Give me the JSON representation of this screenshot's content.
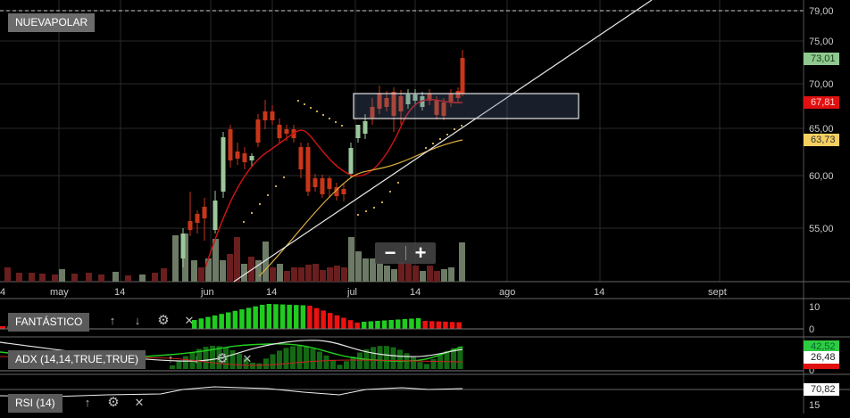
{
  "chart": {
    "symbol": "NUEVAPOLAR",
    "price_axis": {
      "ticks": [
        "79,00",
        "75,00",
        "70,00",
        "65,00",
        "60,00",
        "55,00"
      ],
      "badges": [
        {
          "label": "73,01",
          "color": "#7fbf7f",
          "text": "#1a3a1a"
        },
        {
          "label": "67,81",
          "color": "#e01010",
          "text": "#ffd0d0"
        },
        {
          "label": "63,73",
          "color": "#f5d060",
          "text": "#333"
        }
      ]
    },
    "time_axis": [
      "4",
      "may",
      "14",
      "jun",
      "14",
      "jul",
      "14",
      "ago",
      "14",
      "sept"
    ],
    "zoom": {
      "minus": "−",
      "plus": "+"
    }
  },
  "panels": [
    {
      "label": "FANTÁSTICO",
      "ticks": [
        "10",
        "0"
      ]
    },
    {
      "label": "ADX (14,14,TRUE,TRUE)",
      "ticks": [
        "42,52",
        "26,48",
        "0"
      ],
      "badges": [
        {
          "label": "42,52",
          "color": "#2ecc40"
        },
        {
          "label": "26,48",
          "color": "#ffffff"
        },
        {
          "label": "",
          "color": "#e01010"
        }
      ]
    },
    {
      "label": "RSI (14)",
      "ticks": [
        "70,82",
        "15"
      ],
      "badges": [
        {
          "label": "70,82",
          "color": "#ffffff"
        }
      ]
    }
  ],
  "icons": {
    "up": "arrow-up-icon",
    "down": "arrow-down-icon",
    "gear": "gear-icon",
    "close": "close-icon"
  },
  "glyphs": {
    "up": "↑",
    "down": "↓",
    "gear": "⚙",
    "close": "✕"
  }
}
